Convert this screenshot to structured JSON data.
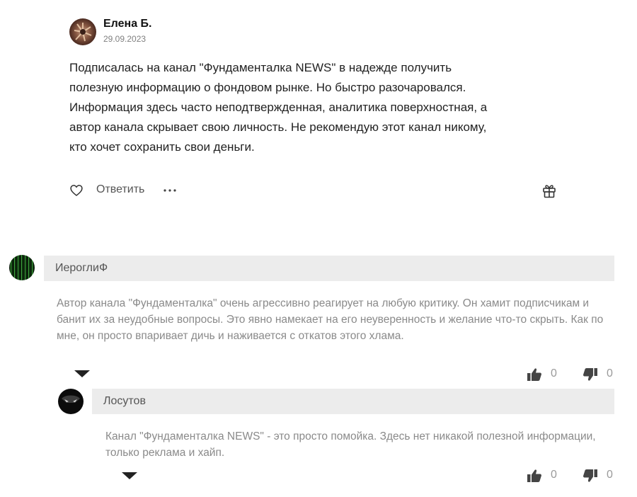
{
  "review": {
    "author": "Елена Б.",
    "date": "29.09.2023",
    "text": "Подписалась на канал \"Фундаменталка NEWS\" в надежде получить полезную информацию о фондовом рынке. Но быстро разочаровался. Информация здесь часто неподтвержденная, аналитика поверхностная, а автор канала скрывает свою личность. Не рекомендую этот канал никому, кто хочет сохранить свои деньги.",
    "reply_label": "Ответить"
  },
  "comments": [
    {
      "author": "ИероглиФ",
      "text": "Автор канала \"Фундаменталка\" очень агрессивно реагирует на любую критику. Он хамит подписчикам и банит их за неудобные вопросы. Это явно намекает на его неуверенность и желание что-то скрыть. Как по мне, он просто впаривает дичь и наживается с откатов этого хлама.",
      "likes": "0",
      "dislikes": "0"
    },
    {
      "author": "Лосутов",
      "text": "Канал \"Фундаменталка NEWS\" - это просто помойка. Здесь нет никакой полезной информации, только реклама и хайп.",
      "likes": "0",
      "dislikes": "0"
    }
  ],
  "icons": {
    "like": "heart-icon",
    "more": "more-icon",
    "gift": "gift-icon",
    "thumbs_up": "thumbs-up-icon",
    "thumbs_down": "thumbs-down-icon",
    "expand": "caret-down-icon"
  }
}
